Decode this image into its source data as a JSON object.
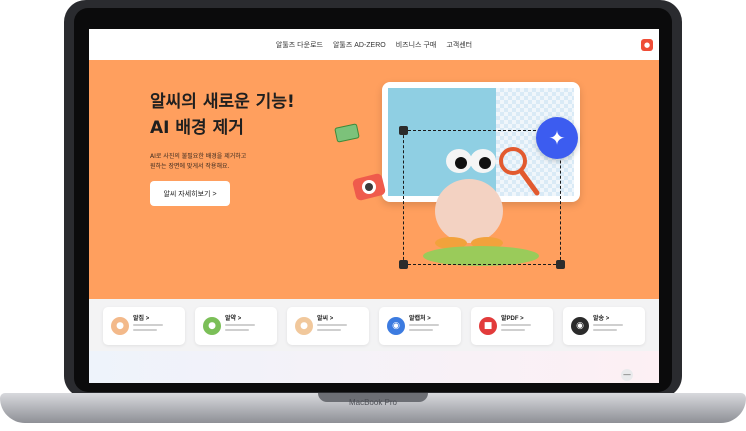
{
  "device": {
    "label": "MacBook Pro"
  },
  "nav": {
    "items": [
      {
        "label": "알툴즈 다운로드"
      },
      {
        "label": "알툴즈 AD-ZERO"
      },
      {
        "label": "비즈니스 구매"
      },
      {
        "label": "고객센터"
      }
    ],
    "badge": "●"
  },
  "hero": {
    "title": "알씨의 새로운 기능!\nAI 배경 제거",
    "description": "AI로 사진의 불필요한 배경을 제거하고\n원하는 장면에 맞게서 작용해요.",
    "cta_label": "알씨 자세히보기 >",
    "sparkle": "✦"
  },
  "cards": [
    {
      "title": "알집 >",
      "icon": "●",
      "color": "#f3b98a"
    },
    {
      "title": "알약 >",
      "icon": "●",
      "color": "#7bbf58"
    },
    {
      "title": "알씨 >",
      "icon": "●",
      "color": "#f1c89c"
    },
    {
      "title": "알캡처 >",
      "icon": "◉",
      "color": "#3c7be0"
    },
    {
      "title": "알PDF >",
      "icon": "■",
      "color": "#e23b3b"
    },
    {
      "title": "알송 >",
      "icon": "◉",
      "color": "#2b2b2b"
    }
  ],
  "scroll": {
    "label": "—"
  }
}
